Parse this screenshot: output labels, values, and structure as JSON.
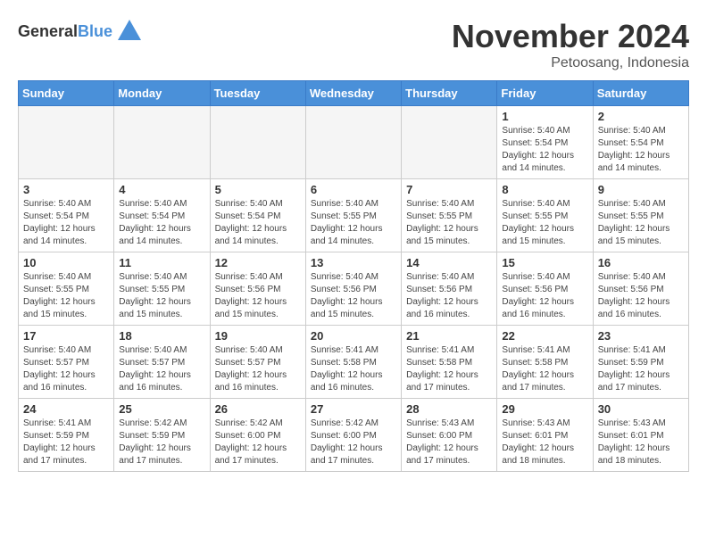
{
  "header": {
    "logo_general": "General",
    "logo_blue": "Blue",
    "month_year": "November 2024",
    "location": "Petoosang, Indonesia"
  },
  "days_of_week": [
    "Sunday",
    "Monday",
    "Tuesday",
    "Wednesday",
    "Thursday",
    "Friday",
    "Saturday"
  ],
  "weeks": [
    [
      {
        "day": "",
        "info": "",
        "empty": true
      },
      {
        "day": "",
        "info": "",
        "empty": true
      },
      {
        "day": "",
        "info": "",
        "empty": true
      },
      {
        "day": "",
        "info": "",
        "empty": true
      },
      {
        "day": "",
        "info": "",
        "empty": true
      },
      {
        "day": "1",
        "info": "Sunrise: 5:40 AM\nSunset: 5:54 PM\nDaylight: 12 hours\nand 14 minutes."
      },
      {
        "day": "2",
        "info": "Sunrise: 5:40 AM\nSunset: 5:54 PM\nDaylight: 12 hours\nand 14 minutes."
      }
    ],
    [
      {
        "day": "3",
        "info": "Sunrise: 5:40 AM\nSunset: 5:54 PM\nDaylight: 12 hours\nand 14 minutes."
      },
      {
        "day": "4",
        "info": "Sunrise: 5:40 AM\nSunset: 5:54 PM\nDaylight: 12 hours\nand 14 minutes."
      },
      {
        "day": "5",
        "info": "Sunrise: 5:40 AM\nSunset: 5:54 PM\nDaylight: 12 hours\nand 14 minutes."
      },
      {
        "day": "6",
        "info": "Sunrise: 5:40 AM\nSunset: 5:55 PM\nDaylight: 12 hours\nand 14 minutes."
      },
      {
        "day": "7",
        "info": "Sunrise: 5:40 AM\nSunset: 5:55 PM\nDaylight: 12 hours\nand 15 minutes."
      },
      {
        "day": "8",
        "info": "Sunrise: 5:40 AM\nSunset: 5:55 PM\nDaylight: 12 hours\nand 15 minutes."
      },
      {
        "day": "9",
        "info": "Sunrise: 5:40 AM\nSunset: 5:55 PM\nDaylight: 12 hours\nand 15 minutes."
      }
    ],
    [
      {
        "day": "10",
        "info": "Sunrise: 5:40 AM\nSunset: 5:55 PM\nDaylight: 12 hours\nand 15 minutes."
      },
      {
        "day": "11",
        "info": "Sunrise: 5:40 AM\nSunset: 5:55 PM\nDaylight: 12 hours\nand 15 minutes."
      },
      {
        "day": "12",
        "info": "Sunrise: 5:40 AM\nSunset: 5:56 PM\nDaylight: 12 hours\nand 15 minutes."
      },
      {
        "day": "13",
        "info": "Sunrise: 5:40 AM\nSunset: 5:56 PM\nDaylight: 12 hours\nand 15 minutes."
      },
      {
        "day": "14",
        "info": "Sunrise: 5:40 AM\nSunset: 5:56 PM\nDaylight: 12 hours\nand 16 minutes."
      },
      {
        "day": "15",
        "info": "Sunrise: 5:40 AM\nSunset: 5:56 PM\nDaylight: 12 hours\nand 16 minutes."
      },
      {
        "day": "16",
        "info": "Sunrise: 5:40 AM\nSunset: 5:56 PM\nDaylight: 12 hours\nand 16 minutes."
      }
    ],
    [
      {
        "day": "17",
        "info": "Sunrise: 5:40 AM\nSunset: 5:57 PM\nDaylight: 12 hours\nand 16 minutes."
      },
      {
        "day": "18",
        "info": "Sunrise: 5:40 AM\nSunset: 5:57 PM\nDaylight: 12 hours\nand 16 minutes."
      },
      {
        "day": "19",
        "info": "Sunrise: 5:40 AM\nSunset: 5:57 PM\nDaylight: 12 hours\nand 16 minutes."
      },
      {
        "day": "20",
        "info": "Sunrise: 5:41 AM\nSunset: 5:58 PM\nDaylight: 12 hours\nand 16 minutes."
      },
      {
        "day": "21",
        "info": "Sunrise: 5:41 AM\nSunset: 5:58 PM\nDaylight: 12 hours\nand 17 minutes."
      },
      {
        "day": "22",
        "info": "Sunrise: 5:41 AM\nSunset: 5:58 PM\nDaylight: 12 hours\nand 17 minutes."
      },
      {
        "day": "23",
        "info": "Sunrise: 5:41 AM\nSunset: 5:59 PM\nDaylight: 12 hours\nand 17 minutes."
      }
    ],
    [
      {
        "day": "24",
        "info": "Sunrise: 5:41 AM\nSunset: 5:59 PM\nDaylight: 12 hours\nand 17 minutes."
      },
      {
        "day": "25",
        "info": "Sunrise: 5:42 AM\nSunset: 5:59 PM\nDaylight: 12 hours\nand 17 minutes."
      },
      {
        "day": "26",
        "info": "Sunrise: 5:42 AM\nSunset: 6:00 PM\nDaylight: 12 hours\nand 17 minutes."
      },
      {
        "day": "27",
        "info": "Sunrise: 5:42 AM\nSunset: 6:00 PM\nDaylight: 12 hours\nand 17 minutes."
      },
      {
        "day": "28",
        "info": "Sunrise: 5:43 AM\nSunset: 6:00 PM\nDaylight: 12 hours\nand 17 minutes."
      },
      {
        "day": "29",
        "info": "Sunrise: 5:43 AM\nSunset: 6:01 PM\nDaylight: 12 hours\nand 18 minutes."
      },
      {
        "day": "30",
        "info": "Sunrise: 5:43 AM\nSunset: 6:01 PM\nDaylight: 12 hours\nand 18 minutes."
      }
    ]
  ]
}
